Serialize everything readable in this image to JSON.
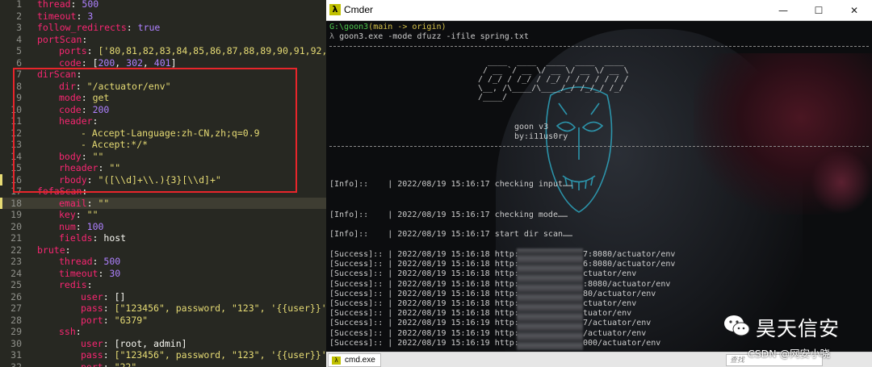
{
  "editor": {
    "lines": [
      {
        "n": "1",
        "key": "thread",
        "val": "500",
        "vt": "n",
        "indent": 0
      },
      {
        "n": "2",
        "key": "timeout",
        "val": "3",
        "vt": "n",
        "indent": 0
      },
      {
        "n": "3",
        "key": "follow_redirects",
        "val": "true",
        "vt": "n",
        "indent": 0
      },
      {
        "n": "4",
        "key": "portScan",
        "val": "",
        "vt": "w",
        "indent": 0
      },
      {
        "n": "5",
        "key": "ports",
        "val": "['80,81,82,83,84,85,86,87,88,89,90,91,92,9",
        "vt": "s",
        "indent": 1
      },
      {
        "n": "6",
        "key": "code",
        "val": "[200, 302, 401]",
        "vt": "arr",
        "indent": 1
      },
      {
        "n": "7",
        "key": "dirScan",
        "val": "",
        "vt": "w",
        "indent": 0
      },
      {
        "n": "8",
        "key": "dir",
        "val": "\"/actuator/env\"",
        "vt": "s",
        "indent": 1
      },
      {
        "n": "9",
        "key": "mode",
        "val": "get",
        "vt": "s",
        "indent": 1
      },
      {
        "n": "10",
        "key": "code",
        "val": "200",
        "vt": "n",
        "indent": 1
      },
      {
        "n": "11",
        "key": "header",
        "val": "",
        "vt": "w",
        "indent": 1
      },
      {
        "n": "12",
        "key": "",
        "val": "- Accept-Language:zh-CN,zh;q=0.9",
        "vt": "s",
        "indent": 2
      },
      {
        "n": "13",
        "key": "",
        "val": "- Accept:*/*",
        "vt": "s",
        "indent": 2
      },
      {
        "n": "14",
        "key": "body",
        "val": "\"\"",
        "vt": "s",
        "indent": 1
      },
      {
        "n": "15",
        "key": "rheader",
        "val": "\"\"",
        "vt": "s",
        "indent": 1
      },
      {
        "n": "16",
        "key": "rbody",
        "val": "\"([\\\\d]+\\\\.){3}[\\\\d]+\"",
        "vt": "s",
        "indent": 1
      },
      {
        "n": "17",
        "key": "fofaScan",
        "val": "",
        "vt": "w",
        "indent": 0
      },
      {
        "n": "18",
        "key": "email",
        "val": "\"\"",
        "vt": "s",
        "indent": 1
      },
      {
        "n": "19",
        "key": "key",
        "val": "\"\"",
        "vt": "s",
        "indent": 1
      },
      {
        "n": "20",
        "key": "num",
        "val": "100",
        "vt": "n",
        "indent": 1
      },
      {
        "n": "21",
        "key": "fields",
        "val": "host",
        "vt": "w",
        "indent": 1
      },
      {
        "n": "22",
        "key": "brute",
        "val": "",
        "vt": "w",
        "indent": 0
      },
      {
        "n": "23",
        "key": "thread",
        "val": "500",
        "vt": "n",
        "indent": 1
      },
      {
        "n": "24",
        "key": "timeout",
        "val": "30",
        "vt": "n",
        "indent": 1
      },
      {
        "n": "25",
        "key": "redis",
        "val": "",
        "vt": "w",
        "indent": 1
      },
      {
        "n": "26",
        "key": "user",
        "val": "[]",
        "vt": "w",
        "indent": 2
      },
      {
        "n": "27",
        "key": "pass",
        "val": "[\"123456\", password, \"123\", '{{user}}',",
        "vt": "s",
        "indent": 2
      },
      {
        "n": "28",
        "key": "port",
        "val": "\"6379\"",
        "vt": "s",
        "indent": 2
      },
      {
        "n": "29",
        "key": "ssh",
        "val": "",
        "vt": "w",
        "indent": 1
      },
      {
        "n": "30",
        "key": "user",
        "val": "[root, admin]",
        "vt": "w",
        "indent": 2
      },
      {
        "n": "31",
        "key": "pass",
        "val": "[\"123456\", password, \"123\", '{{user}}',",
        "vt": "s",
        "indent": 2
      },
      {
        "n": "32",
        "key": "port",
        "val": "\"22\"",
        "vt": "s",
        "indent": 2
      }
    ]
  },
  "window": {
    "title": "Cmder",
    "minimize": "—",
    "maximize": "☐",
    "close": "✕"
  },
  "terminal": {
    "prompt_path": "G:\\goon3",
    "prompt_branch": "(main -> origin)",
    "prompt_symbol": "λ",
    "command": "goon3.exe -mode dfuzz -ifile spring.txt",
    "banner": [
      "  ____  ____  ____  ____  ____",
      " / __ `/ __ \\/ __ \\/ __ \\/ __ \\",
      "/ /_/ / /_/ / /_/ / / / / / / /",
      "\\__, /\\____/\\____/_/ /_/_/ /_/",
      "/____/"
    ],
    "product": "goon v3",
    "author": "by:i11us0ry",
    "info": [
      {
        "tag": "[Info]::",
        "time": "| 2022/08/19 15:16:17",
        "msg": "checking input……"
      },
      {
        "tag": "[Info]::",
        "time": "| 2022/08/19 15:16:17",
        "msg": "checking mode……"
      },
      {
        "tag": "[Info]::",
        "time": "| 2022/08/19 15:16:17",
        "msg": "start dir scan……"
      }
    ],
    "success": [
      {
        "tag": "[Success]::",
        "time": "| 2022/08/19 15:16:18",
        "pre": "http://",
        "post": "7:8080/actuator/env"
      },
      {
        "tag": "[Success]::",
        "time": "| 2022/08/19 15:16:18",
        "pre": "http://",
        "post": "6:8080/actuator/env"
      },
      {
        "tag": "[Success]::",
        "time": "| 2022/08/19 15:16:18",
        "pre": "http://",
        "post": "ctuator/env"
      },
      {
        "tag": "[Success]::",
        "time": "| 2022/08/19 15:16:18",
        "pre": "http://",
        "post": ":8080/actuator/env"
      },
      {
        "tag": "[Success]::",
        "time": "| 2022/08/19 15:16:18",
        "pre": "http://",
        "post": "80/actuator/env"
      },
      {
        "tag": "[Success]::",
        "time": "| 2022/08/19 15:16:18",
        "pre": "http://",
        "post": "ctuator/env"
      },
      {
        "tag": "[Success]::",
        "time": "| 2022/08/19 15:16:18",
        "pre": "http://3",
        "post": "tuator/env"
      },
      {
        "tag": "[Success]::",
        "time": "| 2022/08/19 15:16:19",
        "pre": "http://3",
        "post": "7/actuator/env"
      },
      {
        "tag": "[Success]::",
        "time": "| 2022/08/19 15:16:19",
        "pre": "http://3",
        "post": "/actuator/env"
      },
      {
        "tag": "[Success]::",
        "time": "| 2022/08/19 15:16:19",
        "pre": "http://2",
        "post": "000/actuator/env"
      }
    ]
  },
  "tabbar": {
    "tab_label": "cmd.exe",
    "search_placeholder": "查找"
  },
  "watermark": {
    "brand": "昊天信安",
    "site": "CSDN @网安小晓"
  },
  "colors": {
    "editor_bg": "#272822",
    "key": "#f92672",
    "string": "#e6db74",
    "number": "#ae81ff",
    "highlight_box": "#e8252b",
    "prompt_green": "#4ec94e",
    "terminal_bg": "#0c0d0f"
  }
}
